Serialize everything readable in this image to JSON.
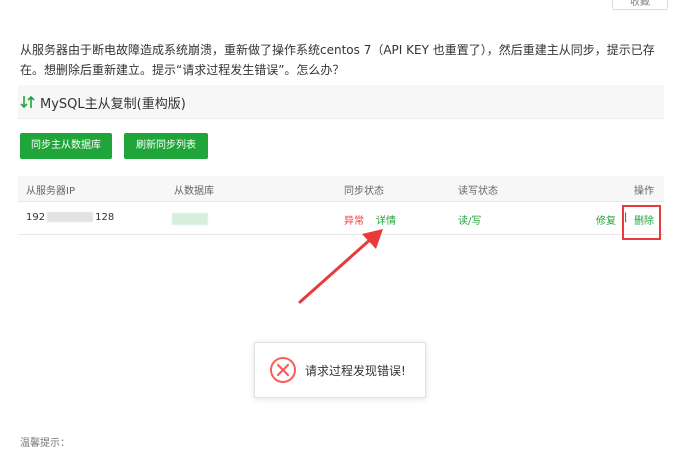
{
  "top": {
    "collect_label": "收藏"
  },
  "question": "从服务器由于断电故障造成系统崩溃，重新做了操作系统centos 7（API KEY 也重置了），然后重建主从同步，提示已存在。想删除后重新建立。提示“请求过程发生错误”。怎么办？",
  "panel": {
    "title": "MySQL主从复制(重构版)"
  },
  "buttons": {
    "sync_db": "同步主从数据库",
    "refresh_list": "刷新同步列表"
  },
  "table": {
    "headers": {
      "slave_ip": "从服务器IP",
      "slave_db": "从数据库",
      "sync_status": "同步状态",
      "rw_status": "读写状态",
      "action": "操作"
    },
    "row": {
      "ip_prefix": "192",
      "ip_suffix": "128",
      "sync_status": "异常",
      "detail": "详情",
      "rw_status": "读/写",
      "repair": "修复",
      "separator": "|",
      "delete": "删除"
    }
  },
  "toast": {
    "message": "请求过程发现错误!"
  },
  "footer_tip": "温馨提示：",
  "colors": {
    "accent_green": "#20a53a",
    "error_red": "#ff3333",
    "annotation_red": "#e83a3a"
  }
}
